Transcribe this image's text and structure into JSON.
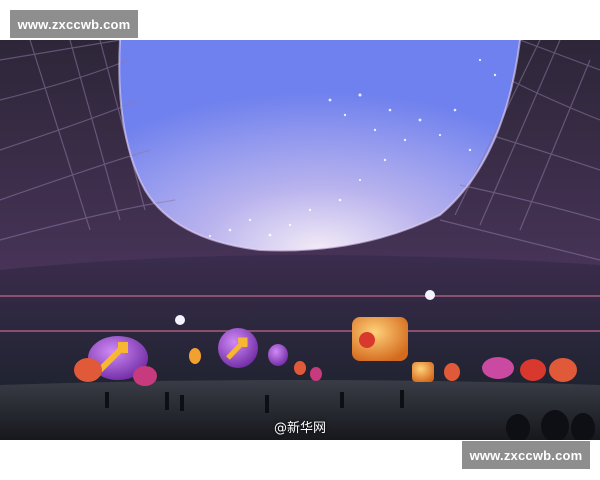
{
  "watermark_top": "www.zxccwb.com",
  "watermark_bottom": "www.zxccwb.com",
  "photo_credit": "@新华网",
  "scene": {
    "sky_colors": [
      "#7f8ff0",
      "#b7b4ee",
      "#e8dcf6"
    ],
    "roof_color": "#3a2f4a",
    "field_color": "#23262c",
    "balloon_colors": [
      "#9b4fd1",
      "#f2a131",
      "#e05a3a",
      "#c73a7d"
    ]
  }
}
